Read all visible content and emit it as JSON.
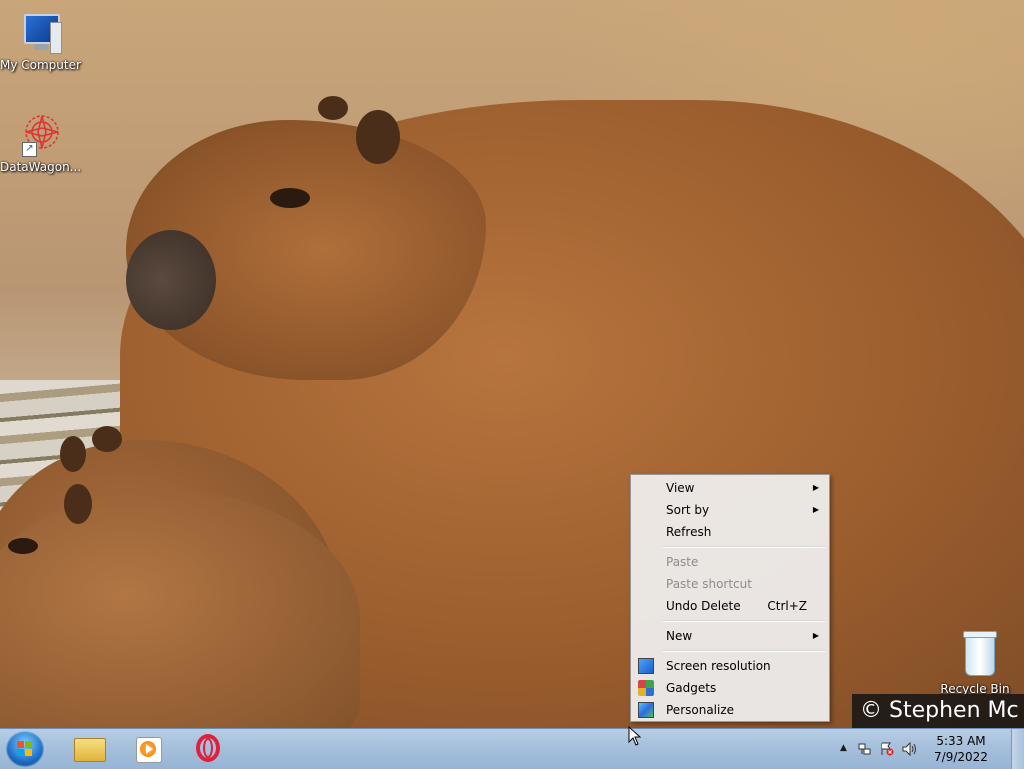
{
  "desktop": {
    "icons": [
      {
        "label": "My Computer",
        "icon": "computer-icon"
      },
      {
        "label": "DataWagon...",
        "icon": "datawagon-icon"
      },
      {
        "label": "Recycle Bin",
        "icon": "recycle-bin-icon"
      }
    ],
    "watermark": "© Stephen Mc"
  },
  "context_menu": {
    "items": [
      {
        "label": "View",
        "has_submenu": true
      },
      {
        "label": "Sort by",
        "has_submenu": true
      },
      {
        "label": "Refresh"
      },
      {
        "label": "Paste",
        "disabled": true
      },
      {
        "label": "Paste shortcut",
        "disabled": true
      },
      {
        "label": "Undo Delete",
        "shortcut": "Ctrl+Z"
      },
      {
        "label": "New",
        "has_submenu": true
      },
      {
        "label": "Screen resolution",
        "icon": "screen-resolution-icon"
      },
      {
        "label": "Gadgets",
        "icon": "gadgets-icon"
      },
      {
        "label": "Personalize",
        "icon": "personalize-icon"
      }
    ],
    "submenu_arrow": "▶"
  },
  "taskbar": {
    "pinned": [
      {
        "name": "Windows Explorer",
        "icon": "folder-icon"
      },
      {
        "name": "Windows Media Player",
        "icon": "media-player-icon"
      },
      {
        "name": "Opera",
        "icon": "opera-icon"
      }
    ],
    "tray": {
      "show_hidden_arrow": "▲",
      "clock_time": "5:33 AM",
      "clock_date": "7/9/2022"
    }
  },
  "colors": {
    "taskbar_top": "#b8cde4",
    "menu_bg": "#f0f0f0",
    "opera_red": "#e0203b"
  }
}
